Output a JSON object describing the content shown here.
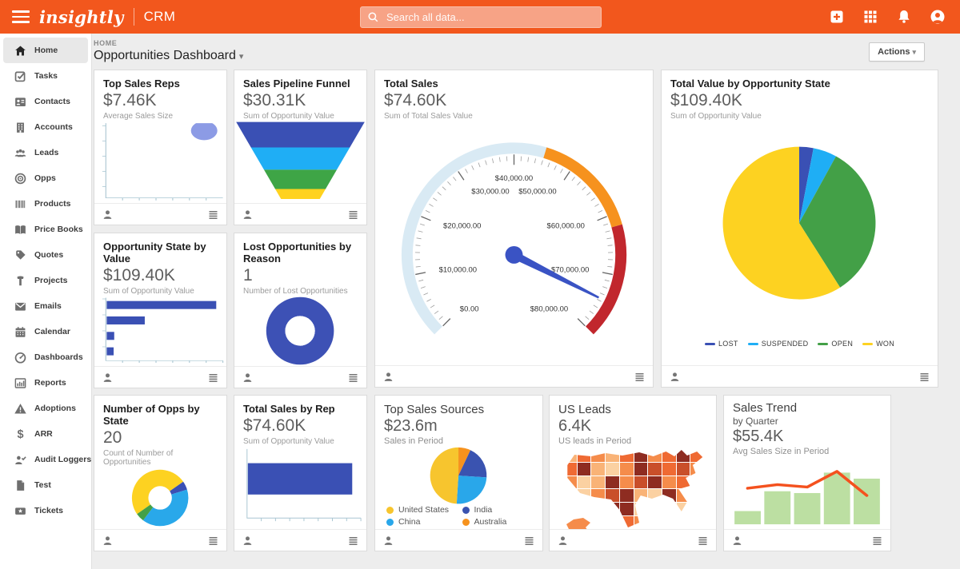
{
  "topbar": {
    "logo": "insightly",
    "app_name": "CRM",
    "search_placeholder": "Search all data...",
    "bg_color": "#F2571D",
    "icons": [
      "hamburger-menu",
      "add",
      "apps-grid",
      "notifications-bell",
      "profile-avatar"
    ]
  },
  "sidebar": {
    "items": [
      {
        "label": "Home",
        "icon": "home",
        "active": true
      },
      {
        "label": "Tasks",
        "icon": "tasks"
      },
      {
        "label": "Contacts",
        "icon": "contacts"
      },
      {
        "label": "Accounts",
        "icon": "accounts"
      },
      {
        "label": "Leads",
        "icon": "leads"
      },
      {
        "label": "Opps",
        "icon": "opps"
      },
      {
        "label": "Products",
        "icon": "products"
      },
      {
        "label": "Price Books",
        "icon": "price-books"
      },
      {
        "label": "Quotes",
        "icon": "quotes"
      },
      {
        "label": "Projects",
        "icon": "projects"
      },
      {
        "label": "Emails",
        "icon": "emails"
      },
      {
        "label": "Calendar",
        "icon": "calendar"
      },
      {
        "label": "Dashboards",
        "icon": "dashboards"
      },
      {
        "label": "Reports",
        "icon": "reports"
      },
      {
        "label": "Adoptions",
        "icon": "adoptions"
      },
      {
        "label": "ARR",
        "icon": "arr"
      },
      {
        "label": "Audit Loggers",
        "icon": "audit-loggers"
      },
      {
        "label": "Test",
        "icon": "test"
      },
      {
        "label": "Tickets",
        "icon": "tickets"
      }
    ]
  },
  "page": {
    "breadcrumb": "HOME",
    "title": "Opportunities Dashboard",
    "actions_label": "Actions"
  },
  "widgets": [
    {
      "id": "top-sales-reps",
      "title": "Top Sales Reps",
      "value": "$7.46K",
      "subtitle": "Average Sales Size",
      "chart_data": {
        "type": "scatter",
        "points": [
          {
            "x_frac": 0.84,
            "y_frac": 0.1,
            "size": 15
          }
        ],
        "color": "#8C9BE5",
        "axis_labels_hidden": true
      }
    },
    {
      "id": "sales-pipeline-funnel",
      "title": "Sales Pipeline Funnel",
      "value": "$30.31K",
      "subtitle": "Sum of Opportunity Value",
      "chart_data": {
        "type": "funnel",
        "segments": [
          {
            "frac": 0.33,
            "color": "#3A50B4"
          },
          {
            "frac": 0.29,
            "color": "#1FAEF5"
          },
          {
            "frac": 0.25,
            "color": "#3EA546"
          },
          {
            "frac": 0.13,
            "color": "#FFD21F"
          }
        ]
      }
    },
    {
      "id": "total-sales",
      "title": "Total Sales",
      "value": "$74.60K",
      "subtitle": "Sum of Total Sales Value",
      "chart_data": {
        "type": "gauge",
        "min": 0,
        "max": 80000,
        "value": 74600,
        "tick_labels": [
          "$0.00",
          "$10,000.00",
          "$20,000.00",
          "$30,000.00",
          "$40,000.00",
          "$50,000.00",
          "$60,000.00",
          "$70,000.00",
          "$80,000.00"
        ],
        "zones": [
          {
            "to": 45000,
            "color": "#D9EAF4"
          },
          {
            "to": 62000,
            "color": "#F6921E"
          },
          {
            "to": 80000,
            "color": "#C1272D"
          }
        ],
        "needle_color": "#3A53C4"
      }
    },
    {
      "id": "total-value-by-opportunity-state",
      "title": "Total Value by Opportunity State",
      "value": "$109.40K",
      "subtitle": "Sum of Opportunity Value",
      "chart_data": {
        "type": "pie",
        "start_deg": 0,
        "legend_position": "bottom",
        "slices": [
          {
            "label": "LOST",
            "frac": 0.03,
            "est_value": 3300,
            "color": "#3A50B4"
          },
          {
            "label": "SUSPENDED",
            "frac": 0.05,
            "est_value": 5500,
            "color": "#1FAEF5"
          },
          {
            "label": "OPEN",
            "frac": 0.33,
            "est_value": 36100,
            "color": "#43A047"
          },
          {
            "label": "WON",
            "frac": 0.59,
            "est_value": 64500,
            "color": "#FDD221"
          }
        ]
      }
    },
    {
      "id": "opportunity-state-by-value",
      "title": "Opportunity State by Value",
      "value": "$109.40K",
      "subtitle": "Sum of Opportunity Value",
      "chart_data": {
        "type": "bar",
        "orientation": "horizontal",
        "color": "#3A50B4",
        "values_pct_of_max": [
          95,
          33,
          6.5,
          6
        ],
        "est_values": [
          64500,
          22500,
          4500,
          4000
        ],
        "axis_labels_hidden": true
      }
    },
    {
      "id": "lost-opportunities-by-reason",
      "title": "Lost Opportunities by Reason",
      "value": "1",
      "subtitle": "Number of Lost Opportunities",
      "chart_data": {
        "type": "pie",
        "donut": true,
        "start_deg": 0,
        "slices": [
          {
            "label": "",
            "frac": 1.0,
            "est_value": 1,
            "color": "#3D51B5"
          }
        ]
      }
    },
    {
      "id": "number-of-opps-by-state",
      "title": "Number of Opps by State",
      "value": "20",
      "subtitle": "Count of Number of Opportunities",
      "chart_data": {
        "type": "pie",
        "donut": true,
        "start_deg": 235,
        "total": 20,
        "slices": [
          {
            "frac": 0.5,
            "est_count": 10,
            "color": "#FDD221"
          },
          {
            "frac": 0.05,
            "est_count": 1,
            "color": "#3A50B4"
          },
          {
            "frac": 0.4,
            "est_count": 8,
            "color": "#29A8EA"
          },
          {
            "frac": 0.05,
            "est_count": 1,
            "color": "#43A047"
          }
        ]
      }
    },
    {
      "id": "total-sales-by-rep",
      "title": "Total Sales by Rep",
      "value": "$74.60K",
      "subtitle": "Sum of Opportunity Value",
      "chart_data": {
        "type": "bar",
        "orientation": "horizontal",
        "color": "#3A50B4",
        "values_pct_of_max": [
          93
        ],
        "est_values": [
          74600
        ],
        "axis_labels_hidden": true
      }
    },
    {
      "id": "top-sales-sources",
      "title": "Top Sales Sources",
      "value": "$23.6m",
      "subtitle": "Sales in Period",
      "chart_data": {
        "type": "pie",
        "start_deg": 0,
        "legend_position": "bottom-grid",
        "slices": [
          {
            "label": "Australia",
            "frac": 0.07,
            "est_value_m": 1.6,
            "color": "#F6921E"
          },
          {
            "label": "India",
            "frac": 0.19,
            "est_value_m": 4.5,
            "color": "#3A53B0"
          },
          {
            "label": "China",
            "frac": 0.25,
            "est_value_m": 5.9,
            "color": "#29A7EA"
          },
          {
            "label": "United States",
            "frac": 0.49,
            "est_value_m": 11.6,
            "color": "#F7C52E"
          }
        ],
        "legend_order": [
          "United States",
          "India",
          "China",
          "Australia"
        ],
        "legend_colors": [
          "#F7C52E",
          "#3A53B0",
          "#29A7EA",
          "#F6921E"
        ]
      }
    },
    {
      "id": "us-leads",
      "title": "US Leads",
      "value": "6.4K",
      "subtitle": "US leads in Period",
      "chart_data": {
        "type": "heatmap",
        "subtype": "us-choropleth",
        "palette": [
          "#FBD1A2",
          "#F9B377",
          "#F58C4B",
          "#EF6A33",
          "#C94F2A",
          "#8E2C21"
        ],
        "grid": [
          [
            "#F9B377",
            "#EF6A33",
            "#F58C4B",
            "#F9B377",
            "#EF6A33",
            "#8E2C21",
            "#F58C4B",
            "#EF6A33",
            "#8E2C21",
            "#EF6A33"
          ],
          [
            "#EF6A33",
            "#8E2C21",
            "#F9B377",
            "#FBD1A2",
            "#F58C4B",
            "#8E2C21",
            "#C94F2A",
            "#EF6A33",
            "#C94F2A",
            "#F58C4B"
          ],
          [
            "#F58C4B",
            "#FBD1A2",
            "#F9B377",
            "#8E2C21",
            "#F58C4B",
            "#C94F2A",
            "#8E2C21",
            "#F58C4B",
            "#EF6A33",
            "#FBD1A2"
          ],
          [
            "#FBD1A2",
            "#FBD1A2",
            "#F58C4B",
            "#C94F2A",
            "#8E2C21",
            "#F9B377",
            "#FBD1A2",
            "#8E2C21",
            "#F58C4B",
            "#F9B377"
          ],
          [
            "#F9B377",
            "#F58C4B",
            "#EF6A33",
            "#8E2C21",
            "#8E2C21",
            "#FBD1A2",
            "#F9B377",
            "#C94F2A",
            "#FBD1A2",
            "#F58C4B"
          ],
          [
            "#FBD1A2",
            "#F9B377",
            "#C94F2A",
            "#8E2C21",
            "#EF6A33",
            "#F58C4B",
            "#FBD1A2",
            "#EF6A33",
            "#F9B377",
            "#FBD1A2"
          ]
        ]
      }
    },
    {
      "id": "sales-trend",
      "title": "Sales Trend",
      "extra": "by Quarter",
      "value": "$55.4K",
      "subtitle": "Avg Sales Size in Period",
      "chart_data": {
        "type": "bar",
        "combo_line": true,
        "bar_color": "#BCDFA2",
        "line_color": "#F4511E",
        "bars_pct": [
          22,
          55,
          52,
          86,
          76
        ],
        "line_pct": [
          60,
          66,
          62,
          88,
          48
        ],
        "axis_hidden": true
      }
    }
  ]
}
